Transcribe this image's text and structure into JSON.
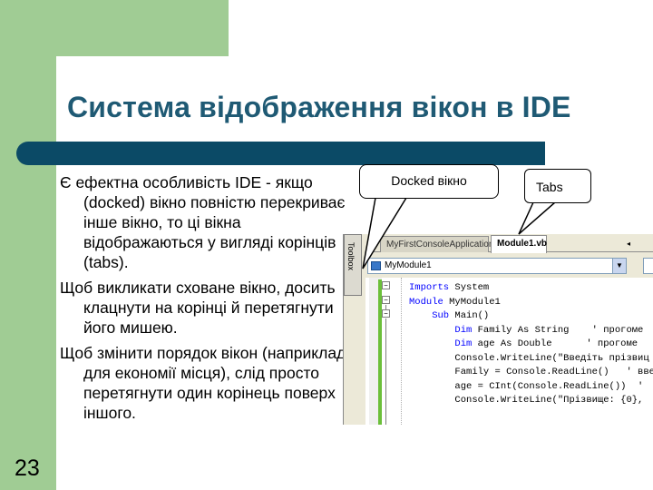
{
  "slide": {
    "number": "23",
    "title": "Система відображення вікон в IDE"
  },
  "body": {
    "paragraphs": [
      "Є ефектна особливість IDE - якщо (docked) вікно повністю перекриває інше вікно, то ці вікна відображаються у вигляді корінців (tabs).",
      "Щоб викликати сховане вікно, досить клацнути на корінці й перетягнути його мишею.",
      "Щоб змінити порядок вікон (наприклад, для економії місця), слід просто перетягнути один корінець поверх іншого."
    ]
  },
  "callouts": {
    "docked": "Docked вікно",
    "tabs": "Tabs"
  },
  "ide": {
    "toolbox_label": "Toolbox",
    "tabs": [
      "MyFirstConsoleApplication",
      "Module1.vb"
    ],
    "dropdown_value": "MyModule1",
    "code_lines": [
      [
        "Imports",
        " System"
      ],
      [
        "Module",
        " MyModule1"
      ],
      [
        "    Sub",
        " Main()"
      ],
      [
        "        Dim",
        " Family As String    ' прогоме"
      ],
      [
        "        Dim",
        " age As Double      ' прогоме"
      ],
      [
        "        ",
        "Console.WriteLine(\"Введіть прізвиц"
      ],
      [
        "        ",
        "Family = Console.ReadLine()   ' вве"
      ],
      [
        "        ",
        "age = CInt(Console.ReadLine())  '"
      ],
      [
        "        ",
        "Console.WriteLine(\"Прізвище: {0},"
      ]
    ]
  },
  "colors": {
    "green": "#a0cc94",
    "title": "#1f5a74",
    "bar": "#0b4a66"
  }
}
